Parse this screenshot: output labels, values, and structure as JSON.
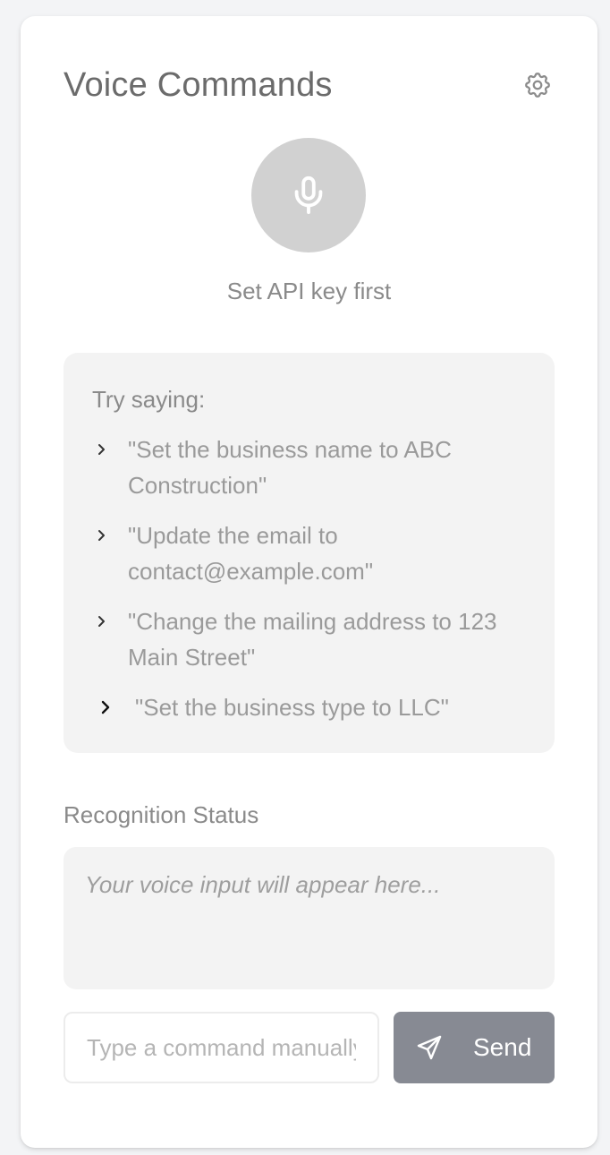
{
  "panel": {
    "title": "Voice Commands",
    "settings_icon": "gear-icon"
  },
  "mic": {
    "icon": "microphone-icon",
    "status": "Set API key first",
    "color": "#d1d1d1"
  },
  "suggestions": {
    "title": "Try saying:",
    "items": [
      "\"Set the business name to ABC Construction\"",
      "\"Update the email to contact@example.com\"",
      "\"Change the mailing address to 123 Main Street\"",
      "\"Set the business type to LLC\""
    ],
    "bullet_icon": "chevron-right-icon"
  },
  "recognition": {
    "label": "Recognition Status",
    "placeholder_text": "Your voice input will appear here..."
  },
  "command": {
    "placeholder": "Type a command manually...",
    "value": "",
    "send_label": "Send",
    "send_icon": "paper-plane-icon",
    "send_color": "#878a93"
  }
}
